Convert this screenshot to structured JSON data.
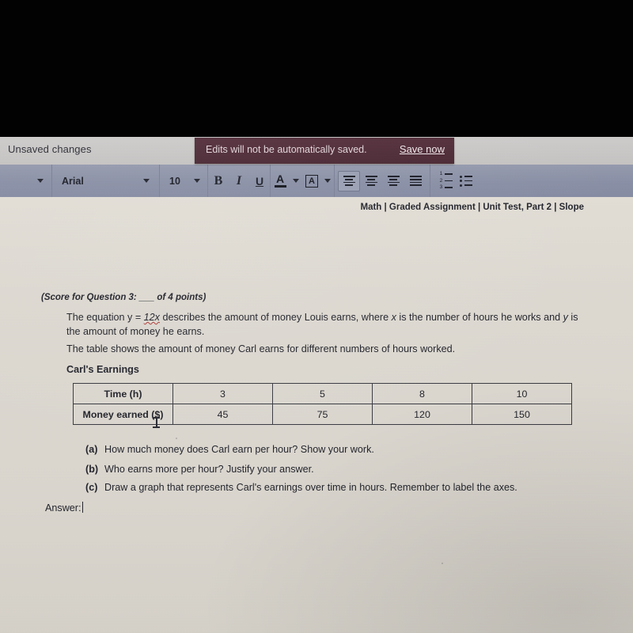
{
  "window": {
    "status_bar": {
      "unsaved_label": "Unsaved changes"
    },
    "save_banner": {
      "message": "Edits will not be automatically saved.",
      "action_label": "Save now"
    }
  },
  "toolbar": {
    "style_dropdown_caret": "chevron-down-icon",
    "font_name": "Arial",
    "font_size": "10",
    "bold_label": "B",
    "italic_label": "I",
    "underline_label": "U",
    "text_color_label": "A",
    "highlight_label": "A",
    "align_left": "align-left-icon",
    "align_center": "align-center-icon",
    "align_right": "align-right-icon",
    "align_justify": "align-justify-icon",
    "numbered_list": "numbered-list-icon",
    "bulleted_list": "bulleted-list-icon"
  },
  "document": {
    "header": "Math | Graded Assignment | Unit Test, Part 2 | Slope",
    "score_line": "(Score for Question 3: ___ of 4 points)",
    "paragraph_1_a": "The equation y = ",
    "paragraph_1_misspelled": "12x",
    "paragraph_1_b": " describes the amount of money Louis earns, where ",
    "paragraph_1_var_x": "x",
    "paragraph_1_c": " is the number of hours he works and ",
    "paragraph_1_var_y": "y",
    "paragraph_1_d": " is the amount of money he earns.",
    "paragraph_2": "The table shows the amount of money Carl earns for different numbers of hours worked.",
    "table_title": "Carl's Earnings",
    "table": {
      "rows": [
        {
          "header": "Time (h)",
          "values": [
            "3",
            "5",
            "8",
            "10"
          ]
        },
        {
          "header": "Money earned ($)",
          "values": [
            "45",
            "75",
            "120",
            "150"
          ]
        }
      ]
    },
    "questions": [
      {
        "label": "(a)",
        "text": "How much money does Carl earn per hour? Show your work."
      },
      {
        "label": "(b)",
        "text": "Who earns more per hour? Justify your answer."
      },
      {
        "label": "(c)",
        "text": "Draw a graph that represents Carl's earnings over time in hours. Remember to label the axes."
      }
    ],
    "answer_label": "Answer:"
  },
  "colors": {
    "banner_bg": "#4e2c38",
    "toolbar_bg": "#8a90a6",
    "status_bg": "#c8c6c6",
    "page_bg": "#dedad2",
    "text": "#23242c",
    "spellcheck_underline": "#b03a33"
  }
}
